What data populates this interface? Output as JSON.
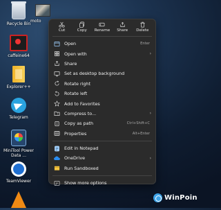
{
  "desktop": {
    "icons": [
      {
        "label": "Recycle Bin"
      },
      {
        "label": "moto"
      },
      {
        "label": "caffeine64"
      },
      {
        "label": "Explorer++"
      },
      {
        "label": "Telegram"
      },
      {
        "label": "MiniTool Power Data ..."
      },
      {
        "label": "TeamViewer"
      },
      {
        "label": "VLC"
      }
    ]
  },
  "context_menu": {
    "quick_actions": [
      {
        "label": "Cut",
        "icon": "scissors-icon"
      },
      {
        "label": "Copy",
        "icon": "copy-icon"
      },
      {
        "label": "Rename",
        "icon": "rename-icon"
      },
      {
        "label": "Share",
        "icon": "share-icon"
      },
      {
        "label": "Delete",
        "icon": "trash-icon"
      }
    ],
    "items": [
      {
        "label": "Open",
        "shortcut": "Enter",
        "icon": "open-icon"
      },
      {
        "label": "Open with",
        "submenu": "›",
        "icon": "open-with-icon"
      },
      {
        "label": "Share",
        "icon": "share-icon"
      },
      {
        "label": "Set as desktop background",
        "icon": "desktop-background-icon"
      },
      {
        "label": "Rotate right",
        "icon": "rotate-right-icon"
      },
      {
        "label": "Rotate left",
        "icon": "rotate-left-icon"
      },
      {
        "label": "Add to Favorites",
        "icon": "star-icon"
      },
      {
        "label": "Compress to...",
        "submenu": "›",
        "icon": "zip-folder-icon"
      },
      {
        "label": "Copy as path",
        "shortcut": "Ctrl+Shift+C",
        "icon": "copy-path-icon"
      },
      {
        "label": "Properties",
        "shortcut": "Alt+Enter",
        "icon": "properties-icon"
      }
    ],
    "items2": [
      {
        "label": "Edit in Notepad",
        "icon": "notepad-icon"
      },
      {
        "label": "OneDrive",
        "submenu": "›",
        "icon": "onedrive-icon"
      },
      {
        "label": "Run Sandboxed",
        "icon": "sandbox-icon"
      }
    ],
    "items3": [
      {
        "label": "Show more options",
        "icon": "more-options-icon"
      }
    ]
  },
  "watermark": {
    "text": "WinPoin"
  },
  "colors": {
    "menu_bg": "#2b2b2b",
    "accent": "#60b4f0"
  }
}
